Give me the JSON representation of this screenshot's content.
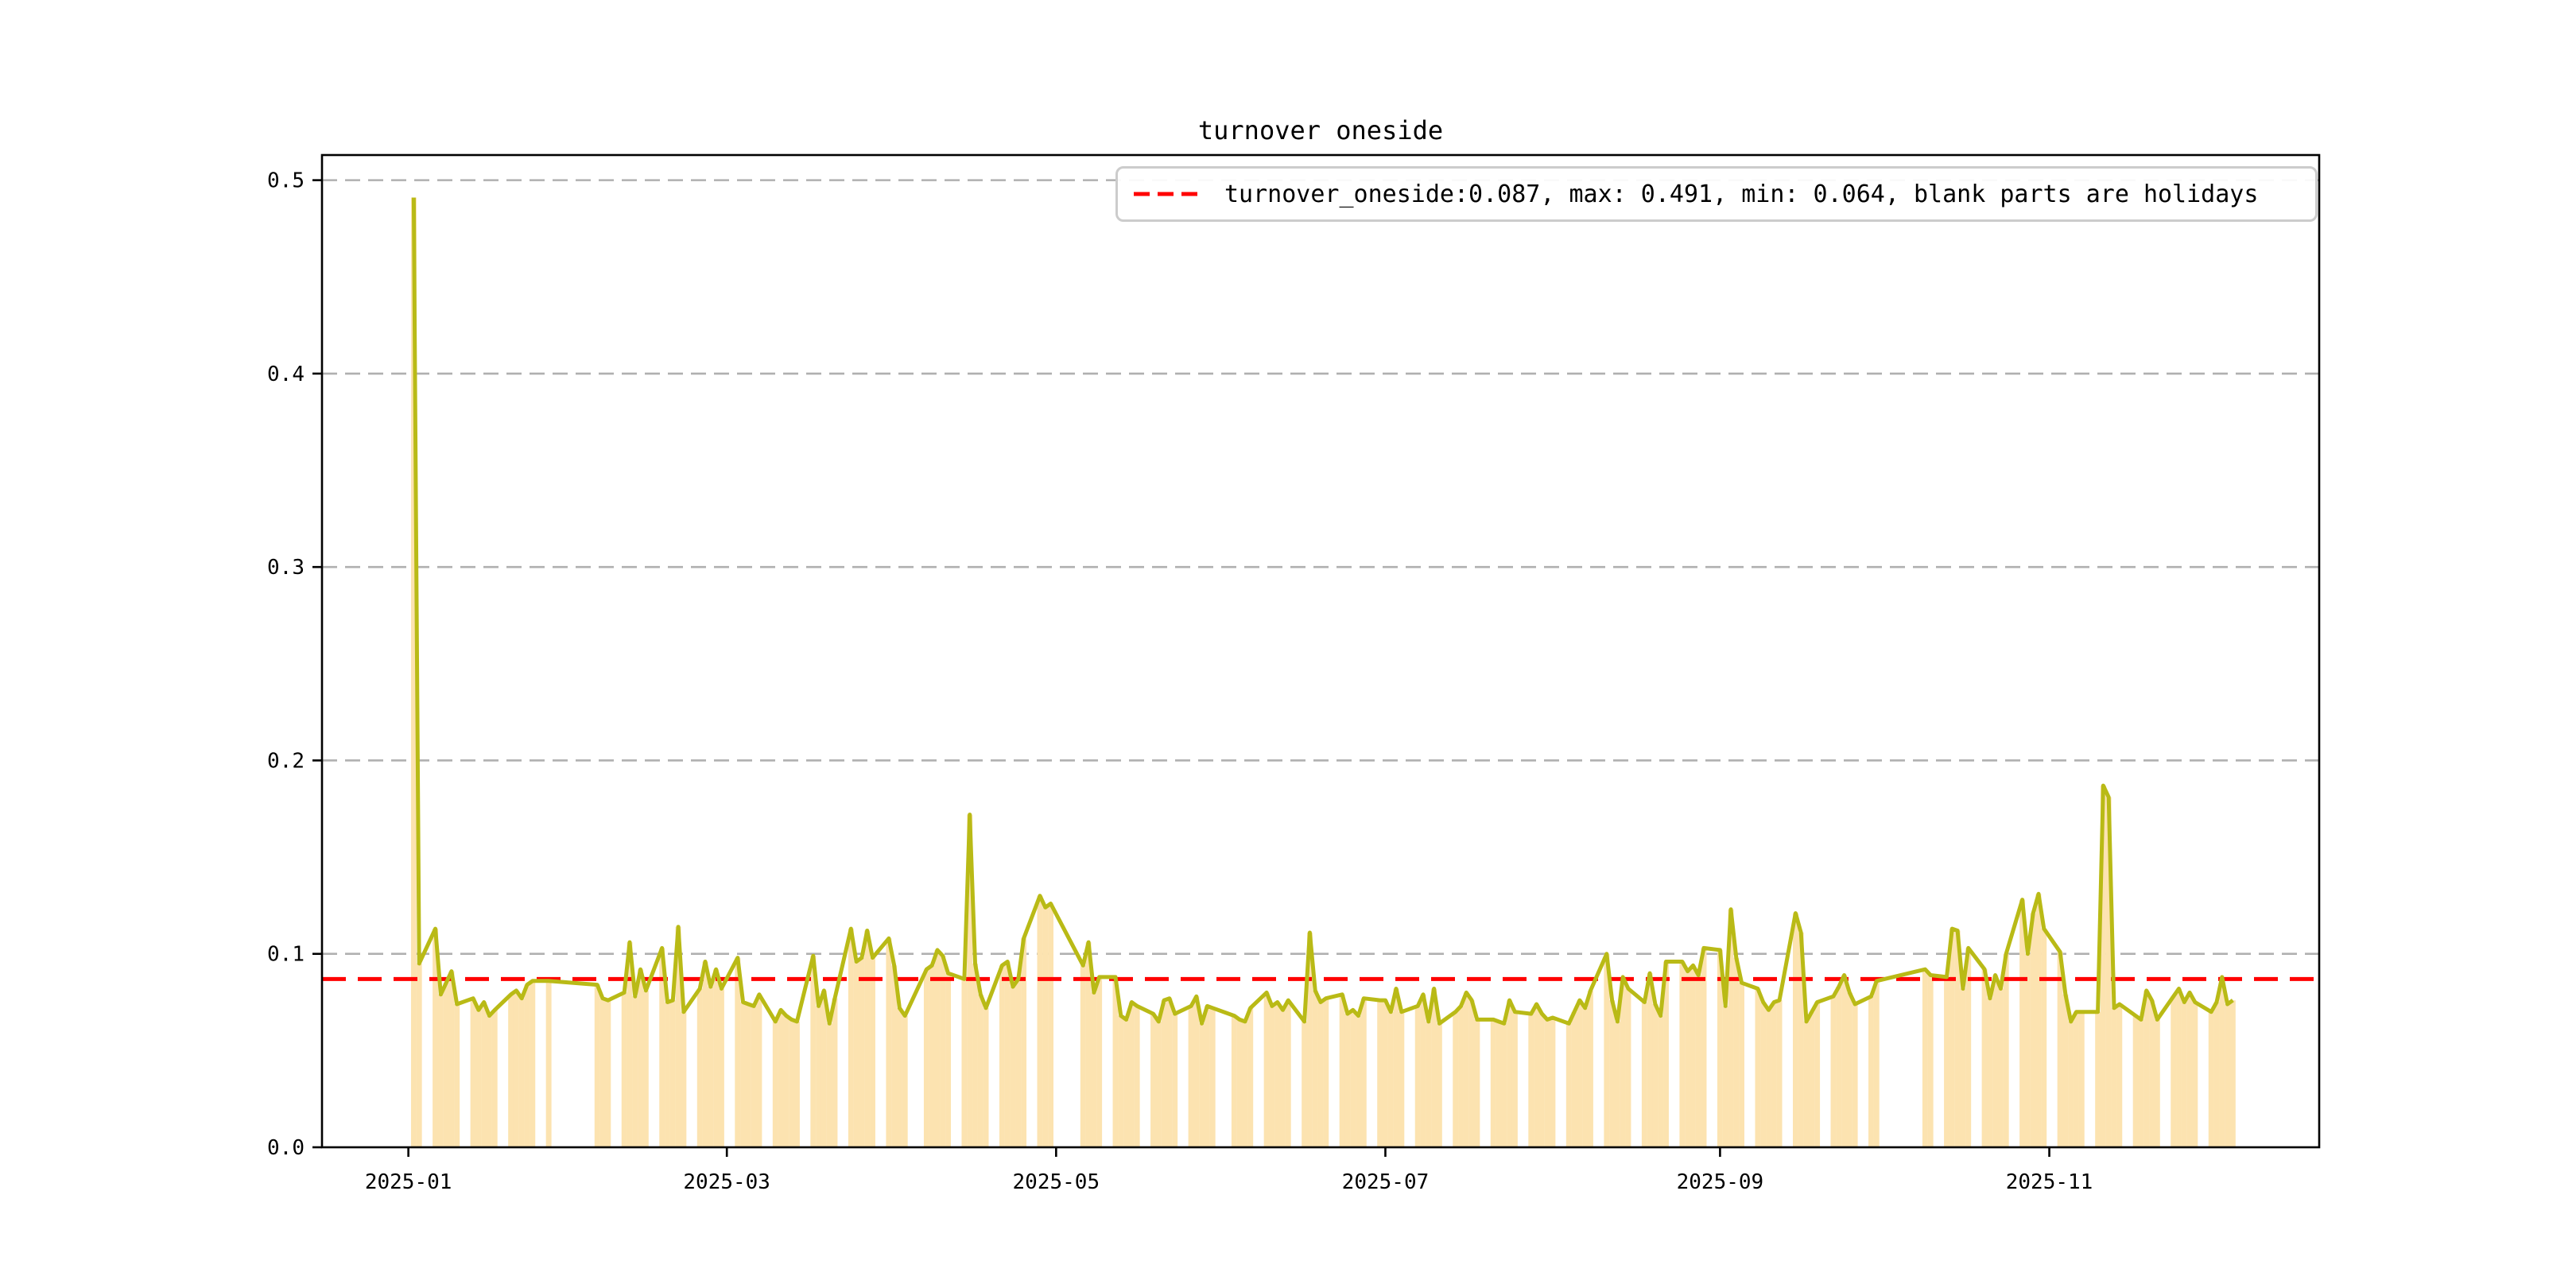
{
  "figure": {
    "background": "#ffffff"
  },
  "chart_data": {
    "type": "bar+line",
    "title": "turnover oneside",
    "legend_label": "turnover_oneside:0.087, max: 0.491, min: 0.064, blank parts are holidays",
    "legend_position": "upper right",
    "stats": {
      "turnover_oneside": 0.087,
      "max": 0.491,
      "min": 0.064
    },
    "hline_value": 0.087,
    "ylim": [
      0,
      0.513
    ],
    "xlim_dates": [
      "2024-12-16",
      "2025-12-21"
    ],
    "ytick_values": [
      0,
      0.1,
      0.2,
      0.3,
      0.4,
      0.5
    ],
    "ytick_labels": [
      "0.0",
      "0.1",
      "0.2",
      "0.3",
      "0.4",
      "0.5"
    ],
    "xticks": [
      {
        "date": "2025-01-01",
        "label": "2025-01"
      },
      {
        "date": "2025-03-01",
        "label": "2025-03"
      },
      {
        "date": "2025-05-01",
        "label": "2025-05"
      },
      {
        "date": "2025-07-01",
        "label": "2025-07"
      },
      {
        "date": "2025-09-01",
        "label": "2025-09"
      },
      {
        "date": "2025-11-01",
        "label": "2025-11"
      }
    ],
    "grid": "dashed-horizontal",
    "colors": {
      "line": "#b9ba16",
      "bar": "#fce3b0",
      "hline": "#ff0000",
      "grid": "#b0b0b0",
      "spine": "#000000",
      "legend_border": "#cccccc",
      "text": "#000000"
    },
    "series": {
      "name": "turnover_oneside",
      "dates": [
        "2025-01-02",
        "2025-01-03",
        "2025-01-06",
        "2025-01-07",
        "2025-01-08",
        "2025-01-09",
        "2025-01-10",
        "2025-01-13",
        "2025-01-14",
        "2025-01-15",
        "2025-01-16",
        "2025-01-17",
        "2025-01-20",
        "2025-01-21",
        "2025-01-22",
        "2025-01-23",
        "2025-01-24",
        "2025-01-27",
        "2025-02-05",
        "2025-02-06",
        "2025-02-07",
        "2025-02-10",
        "2025-02-11",
        "2025-02-12",
        "2025-02-13",
        "2025-02-14",
        "2025-02-17",
        "2025-02-18",
        "2025-02-19",
        "2025-02-20",
        "2025-02-21",
        "2025-02-24",
        "2025-02-25",
        "2025-02-26",
        "2025-02-27",
        "2025-02-28",
        "2025-03-03",
        "2025-03-04",
        "2025-03-05",
        "2025-03-06",
        "2025-03-07",
        "2025-03-10",
        "2025-03-11",
        "2025-03-12",
        "2025-03-13",
        "2025-03-14",
        "2025-03-17",
        "2025-03-18",
        "2025-03-19",
        "2025-03-20",
        "2025-03-21",
        "2025-03-24",
        "2025-03-25",
        "2025-03-26",
        "2025-03-27",
        "2025-03-28",
        "2025-03-31",
        "2025-04-01",
        "2025-04-02",
        "2025-04-03",
        "2025-04-07",
        "2025-04-08",
        "2025-04-09",
        "2025-04-10",
        "2025-04-11",
        "2025-04-14",
        "2025-04-15",
        "2025-04-16",
        "2025-04-17",
        "2025-04-18",
        "2025-04-21",
        "2025-04-22",
        "2025-04-23",
        "2025-04-24",
        "2025-04-25",
        "2025-04-28",
        "2025-04-29",
        "2025-04-30",
        "2025-05-06",
        "2025-05-07",
        "2025-05-08",
        "2025-05-09",
        "2025-05-12",
        "2025-05-13",
        "2025-05-14",
        "2025-05-15",
        "2025-05-16",
        "2025-05-19",
        "2025-05-20",
        "2025-05-21",
        "2025-05-22",
        "2025-05-23",
        "2025-05-26",
        "2025-05-27",
        "2025-05-28",
        "2025-05-29",
        "2025-05-30",
        "2025-06-03",
        "2025-06-04",
        "2025-06-05",
        "2025-06-06",
        "2025-06-09",
        "2025-06-10",
        "2025-06-11",
        "2025-06-12",
        "2025-06-13",
        "2025-06-16",
        "2025-06-17",
        "2025-06-18",
        "2025-06-19",
        "2025-06-20",
        "2025-06-23",
        "2025-06-24",
        "2025-06-25",
        "2025-06-26",
        "2025-06-27",
        "2025-06-30",
        "2025-07-01",
        "2025-07-02",
        "2025-07-03",
        "2025-07-04",
        "2025-07-07",
        "2025-07-08",
        "2025-07-09",
        "2025-07-10",
        "2025-07-11",
        "2025-07-14",
        "2025-07-15",
        "2025-07-16",
        "2025-07-17",
        "2025-07-18",
        "2025-07-21",
        "2025-07-22",
        "2025-07-23",
        "2025-07-24",
        "2025-07-25",
        "2025-07-28",
        "2025-07-29",
        "2025-07-30",
        "2025-07-31",
        "2025-08-01",
        "2025-08-04",
        "2025-08-05",
        "2025-08-06",
        "2025-08-07",
        "2025-08-08",
        "2025-08-11",
        "2025-08-12",
        "2025-08-13",
        "2025-08-14",
        "2025-08-15",
        "2025-08-18",
        "2025-08-19",
        "2025-08-20",
        "2025-08-21",
        "2025-08-22",
        "2025-08-25",
        "2025-08-26",
        "2025-08-27",
        "2025-08-28",
        "2025-08-29",
        "2025-09-01",
        "2025-09-02",
        "2025-09-03",
        "2025-09-04",
        "2025-09-05",
        "2025-09-08",
        "2025-09-09",
        "2025-09-10",
        "2025-09-11",
        "2025-09-12",
        "2025-09-15",
        "2025-09-16",
        "2025-09-17",
        "2025-09-18",
        "2025-09-19",
        "2025-09-22",
        "2025-09-23",
        "2025-09-24",
        "2025-09-25",
        "2025-09-26",
        "2025-09-29",
        "2025-09-30",
        "2025-10-09",
        "2025-10-10",
        "2025-10-13",
        "2025-10-14",
        "2025-10-15",
        "2025-10-16",
        "2025-10-17",
        "2025-10-20",
        "2025-10-21",
        "2025-10-22",
        "2025-10-23",
        "2025-10-24",
        "2025-10-27",
        "2025-10-28",
        "2025-10-29",
        "2025-10-30",
        "2025-10-31",
        "2025-11-03",
        "2025-11-04",
        "2025-11-05",
        "2025-11-06",
        "2025-11-07",
        "2025-11-10",
        "2025-11-11",
        "2025-11-12",
        "2025-11-13",
        "2025-11-14",
        "2025-11-17",
        "2025-11-18",
        "2025-11-19",
        "2025-11-20",
        "2025-11-21",
        "2025-11-24",
        "2025-11-25",
        "2025-11-26",
        "2025-11-27",
        "2025-11-28",
        "2025-12-01",
        "2025-12-02",
        "2025-12-03",
        "2025-12-04",
        "2025-12-05"
      ],
      "values": [
        0.491,
        0.095,
        0.113,
        0.079,
        0.085,
        0.091,
        0.074,
        0.077,
        0.071,
        0.075,
        0.068,
        0.071,
        0.079,
        0.081,
        0.077,
        0.084,
        0.086,
        0.086,
        0.084,
        0.077,
        0.076,
        0.08,
        0.106,
        0.078,
        0.092,
        0.081,
        0.103,
        0.075,
        0.076,
        0.114,
        0.07,
        0.082,
        0.096,
        0.083,
        0.092,
        0.082,
        0.098,
        0.075,
        0.074,
        0.073,
        0.079,
        0.065,
        0.071,
        0.068,
        0.066,
        0.065,
        0.099,
        0.073,
        0.081,
        0.064,
        0.077,
        0.113,
        0.096,
        0.098,
        0.112,
        0.098,
        0.108,
        0.094,
        0.072,
        0.068,
        0.092,
        0.094,
        0.102,
        0.099,
        0.09,
        0.087,
        0.172,
        0.095,
        0.079,
        0.072,
        0.094,
        0.096,
        0.083,
        0.087,
        0.108,
        0.13,
        0.124,
        0.126,
        0.094,
        0.106,
        0.08,
        0.088,
        0.088,
        0.068,
        0.066,
        0.075,
        0.073,
        0.069,
        0.065,
        0.076,
        0.077,
        0.069,
        0.073,
        0.078,
        0.064,
        0.073,
        0.072,
        0.068,
        0.066,
        0.065,
        0.072,
        0.08,
        0.073,
        0.075,
        0.071,
        0.076,
        0.065,
        0.111,
        0.081,
        0.075,
        0.077,
        0.079,
        0.069,
        0.071,
        0.068,
        0.077,
        0.076,
        0.076,
        0.07,
        0.082,
        0.07,
        0.073,
        0.079,
        0.065,
        0.082,
        0.064,
        0.07,
        0.073,
        0.08,
        0.076,
        0.066,
        0.066,
        0.065,
        0.064,
        0.076,
        0.07,
        0.069,
        0.074,
        0.069,
        0.066,
        0.067,
        0.064,
        0.07,
        0.076,
        0.072,
        0.081,
        0.1,
        0.076,
        0.065,
        0.088,
        0.082,
        0.075,
        0.09,
        0.074,
        0.068,
        0.096,
        0.096,
        0.091,
        0.094,
        0.089,
        0.103,
        0.102,
        0.073,
        0.123,
        0.098,
        0.085,
        0.082,
        0.075,
        0.071,
        0.075,
        0.076,
        0.121,
        0.111,
        0.065,
        0.07,
        0.075,
        0.078,
        0.083,
        0.089,
        0.08,
        0.074,
        0.078,
        0.086,
        0.092,
        0.089,
        0.088,
        0.113,
        0.112,
        0.082,
        0.103,
        0.092,
        0.077,
        0.089,
        0.082,
        0.1,
        0.128,
        0.1,
        0.121,
        0.131,
        0.113,
        0.101,
        0.079,
        0.065,
        0.07,
        0.07,
        0.07,
        0.187,
        0.181,
        0.072,
        0.074,
        0.068,
        0.066,
        0.081,
        0.076,
        0.066,
        0.078,
        0.082,
        0.075,
        0.08,
        0.075,
        0.07,
        0.075,
        0.088,
        0.074,
        0.076
      ]
    }
  }
}
